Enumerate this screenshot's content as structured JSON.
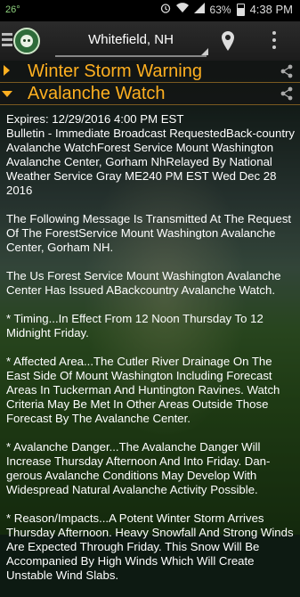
{
  "statusbar": {
    "temperature": "26°",
    "battery_pct_text": "63%",
    "battery_level": 0.63,
    "time": "4:38 PM"
  },
  "appbar": {
    "location": "Whitefield, NH"
  },
  "alerts": [
    {
      "title": "Winter Storm Warning",
      "expanded": false
    },
    {
      "title": "Avalanche Watch",
      "expanded": true
    }
  ],
  "content": {
    "paragraphs": [
      "Expires: 12/29/2016 4:00 PM EST\n Bulletin - Immediate Broadcast RequestedBack-country Avalanche WatchForest Service Mount Washington Avalanche Center, Gorham NhRelayed By National Weather Service Gray ME240 PM EST Wed Dec 28 2016",
      "The Following Message Is Transmitted At The Request Of The ForestService Mount Washington Avalanche Center, Gorham NH.",
      "The Us Forest Service Mount Washington Avalanche Center Has Issued ABackcountry Avalanche Watch.",
      "* Timing...In Effect From 12 Noon Thursday To 12 Midnight Friday.",
      "* Affected Area...The Cutler River Drainage On The East Side Of  Mount Washington Including Forecast Areas In Tuckerman And  Huntington Ravines. Watch Criteria May Be Met In Other Areas Outside Those Forecast By The Avalanche Center.",
      "* Avalanche Danger...The Avalanche Danger Will Increase Thursday  Afternoon And Into Friday. Dan-gerous Avalanche Conditions May  Develop With Widespread Natural Avalanche Activity Possible.",
      "* Reason/Impacts...A Potent Winter Storm Arrives Thursday  Afternoon. Heavy Snowfall And Strong Winds Are Expected Through  Friday. This Snow Will Be Accompanied By High Winds Which Will Create Unstable Wind Slabs."
    ]
  }
}
